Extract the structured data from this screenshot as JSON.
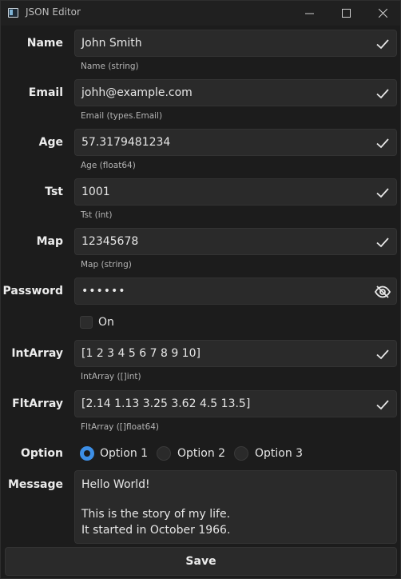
{
  "window": {
    "title": "JSON Editor",
    "app_icon": "window-icon",
    "controls": [
      "minimize-icon",
      "maximize-icon",
      "close-icon"
    ]
  },
  "fields": {
    "name": {
      "label": "Name",
      "value": "John Smith",
      "hint": "Name (string)"
    },
    "email": {
      "label": "Email",
      "value": "johh@example.com",
      "hint": "Email (types.Email)"
    },
    "age": {
      "label": "Age",
      "value": "57.3179481234",
      "hint": "Age (float64)"
    },
    "tst": {
      "label": "Tst",
      "value": "1001",
      "hint": "Tst (int)"
    },
    "map": {
      "label": "Map",
      "value": "12345678",
      "hint": "Map (string)"
    },
    "password": {
      "label": "Password",
      "value": "••••••"
    },
    "toggle": {
      "label": "On",
      "checked": false
    },
    "intarray": {
      "label": "IntArray",
      "value": "[1 2 3 4 5 6 7 8 9 10]",
      "hint": "IntArray ([]int)"
    },
    "fltarray": {
      "label": "FltArray",
      "value": "[2.14 1.13 3.25 3.62 4.5 13.5]",
      "hint": "FltArray ([]float64)"
    },
    "option": {
      "label": "Option",
      "options": [
        "Option 1",
        "Option 2",
        "Option 3"
      ],
      "selected": "Option 1"
    },
    "message": {
      "label": "Message",
      "lines": [
        "Hello World!",
        "",
        "This is the story of my life.",
        "It started in October 1966."
      ]
    }
  },
  "actions": {
    "save_label": "Save"
  },
  "colors": {
    "accent": "#3d8fe6",
    "background": "#1c1c1c",
    "field": "#2a2a2a"
  },
  "icons": {
    "valid": "check-icon",
    "reveal": "eye-off-icon"
  }
}
